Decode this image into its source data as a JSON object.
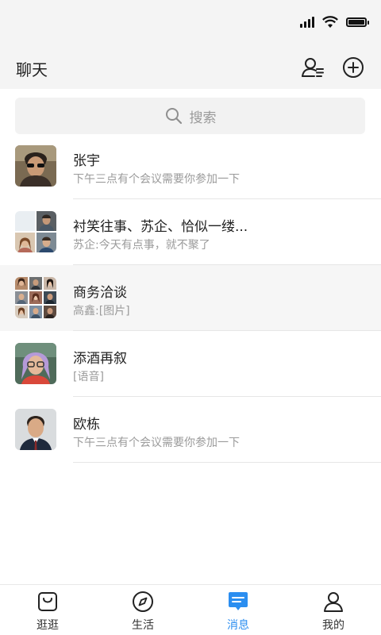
{
  "status_bar": {
    "icons": [
      "signal-icon",
      "wifi-icon",
      "battery-icon"
    ],
    "battery_level": 0.9
  },
  "header": {
    "title": "聊天",
    "actions": [
      "contacts-icon",
      "add-icon"
    ]
  },
  "search": {
    "placeholder": "搜索",
    "icon": "search-icon"
  },
  "chats": [
    {
      "name": "张宇",
      "preview": "下午三点有个会议需要你参加一下",
      "avatar": "single-photo"
    },
    {
      "name": "衬笑往事、苏企、恰似一缕...",
      "preview": "苏企:今天有点事，就不聚了",
      "avatar": "group-4-photos"
    },
    {
      "name": "商务洽谈",
      "preview": "高鑫:[图片]",
      "avatar": "group-9-photos",
      "highlighted": true
    },
    {
      "name": "添酒再叙",
      "preview": "[语音]",
      "avatar": "single-photo"
    },
    {
      "name": "欧栋",
      "preview": "下午三点有个会议需要你参加一下",
      "avatar": "single-photo"
    }
  ],
  "tabs": [
    {
      "label": "逛逛",
      "icon": "shopping-bag-icon"
    },
    {
      "label": "生活",
      "icon": "compass-icon"
    },
    {
      "label": "消息",
      "icon": "message-icon",
      "active": true
    },
    {
      "label": "我的",
      "icon": "person-icon"
    }
  ],
  "colors": {
    "accent": "#2b8ef0",
    "background_top": "#f4f4f4"
  }
}
